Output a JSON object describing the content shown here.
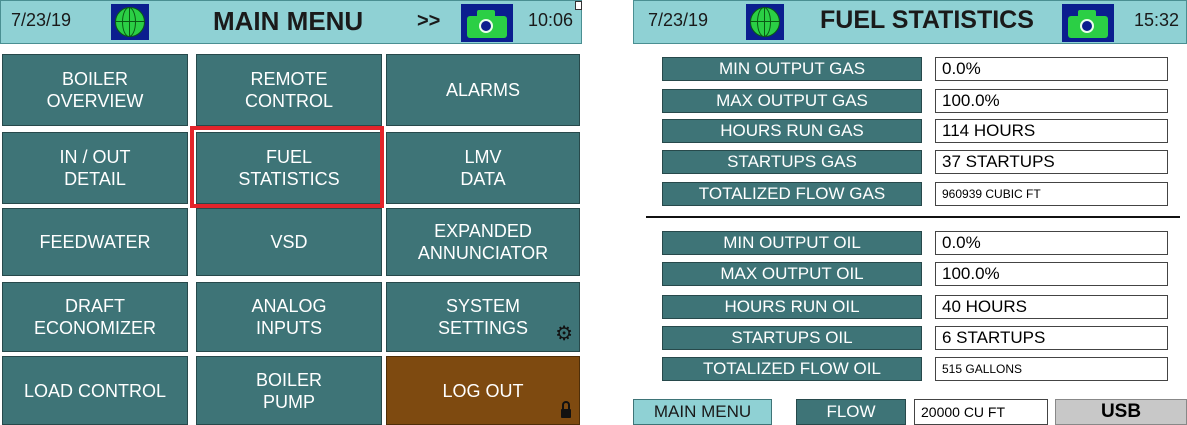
{
  "main_menu": {
    "header": {
      "date": "7/23/19",
      "title": "MAIN MENU",
      "arrows": ">>",
      "time": "10:06"
    },
    "icons": {
      "globe": "globe-icon",
      "camera": "camera-icon",
      "gear": "gear-icon",
      "lock": "lock-icon"
    },
    "buttons": [
      "BOILER\nOVERVIEW",
      "REMOTE\nCONTROL",
      "ALARMS",
      "IN / OUT\nDETAIL",
      "FUEL\nSTATISTICS",
      "LMV\nDATA",
      "FEEDWATER",
      "VSD",
      "EXPANDED\nANNUNCIATOR",
      "DRAFT\nECONOMIZER",
      "ANALOG\nINPUTS",
      "SYSTEM\nSETTINGS",
      "LOAD CONTROL",
      "BOILER\nPUMP",
      "LOG OUT"
    ],
    "selected": "FUEL\nSTATISTICS"
  },
  "fuel_stats": {
    "header": {
      "date": "7/23/19",
      "title": "FUEL STATISTICS",
      "time": "15:32"
    },
    "gas": [
      {
        "label": "MIN OUTPUT GAS",
        "value": "0.0%"
      },
      {
        "label": "MAX OUTPUT GAS",
        "value": "100.0%"
      },
      {
        "label": "HOURS RUN GAS",
        "value": "114 HOURS"
      },
      {
        "label": "STARTUPS GAS",
        "value": "37 STARTUPS"
      },
      {
        "label": "TOTALIZED FLOW GAS",
        "value": "960939 CUBIC FT"
      }
    ],
    "oil": [
      {
        "label": "MIN OUTPUT OIL",
        "value": "0.0%"
      },
      {
        "label": "MAX OUTPUT OIL",
        "value": "100.0%"
      },
      {
        "label": "HOURS RUN OIL",
        "value": "40 HOURS"
      },
      {
        "label": "STARTUPS OIL",
        "value": "6 STARTUPS"
      },
      {
        "label": "TOTALIZED FLOW OIL",
        "value": "515 GALLONS"
      }
    ],
    "footer": {
      "main_menu": "MAIN MENU",
      "flow_label": "FLOW",
      "flow_value": "20000 CU FT",
      "usb": "USB"
    }
  },
  "colors": {
    "header_bg": "#8fd1d4",
    "button_bg": "#3e7477",
    "logout_bg": "#7e4a10",
    "selection": "#e3242b",
    "icon_bg": "#0b1e8f",
    "icon_fg": "#2bcf45"
  }
}
